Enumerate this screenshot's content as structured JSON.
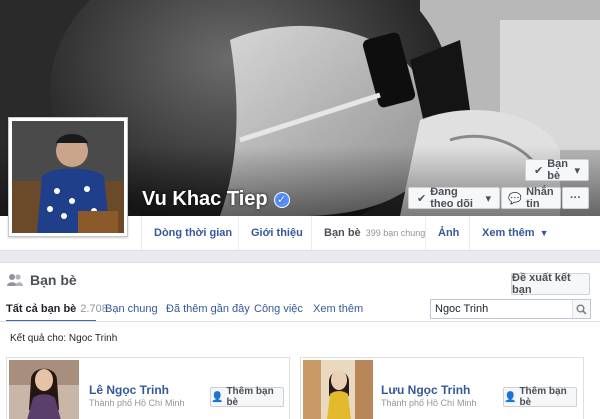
{
  "profile": {
    "name": "Vu Khac Tiep",
    "verified": true
  },
  "cover_actions": {
    "friends_label": "Bạn bè",
    "following_label": "Đang theo dõi",
    "message_label": "Nhắn tin",
    "more_label": "···"
  },
  "tabs": [
    {
      "label": "Dòng thời gian"
    },
    {
      "label": "Giới thiệu"
    },
    {
      "label": "Bạn bè",
      "sub": "399 bạn chung"
    },
    {
      "label": "Ảnh"
    },
    {
      "label": "Xem thêm"
    }
  ],
  "friends_panel": {
    "title": "Bạn bè",
    "suggest_label": "Đề xuất kết bạn",
    "filters": [
      {
        "label": "Tất cả bạn bè",
        "count": "2.708",
        "active": true
      },
      {
        "label": "Bạn chung"
      },
      {
        "label": "Đã thêm gần đây"
      },
      {
        "label": "Công việc"
      },
      {
        "label": "Xem thêm"
      }
    ],
    "search_value": "Ngoc Trinh",
    "results_label": "Kết quả cho: Ngoc Trinh"
  },
  "results": [
    {
      "name": "Lê Ngọc Trinh",
      "location": "Thành phố Hồ Chí Minh",
      "add_label": "Thêm bạn bè"
    },
    {
      "name": "Lưu Ngọc Trinh",
      "location": "Thành phố Hồ Chí Minh",
      "add_label": "Thêm bạn bè"
    }
  ],
  "colors": {
    "link_blue": "#365899",
    "accent_blue": "#4267b2",
    "page_bg": "#e9ebee"
  }
}
